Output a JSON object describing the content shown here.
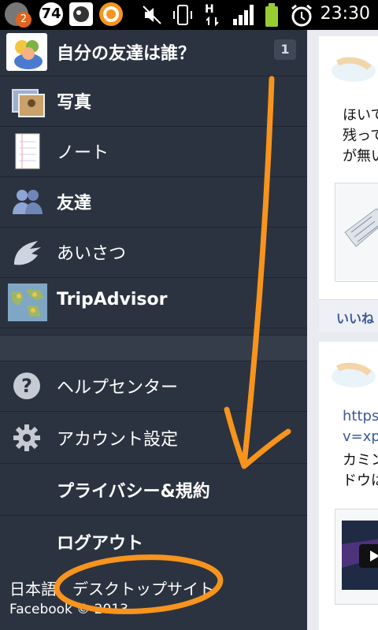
{
  "status_bar": {
    "notif_count": "2",
    "battery_badge": "74",
    "network": "H",
    "time": "23:30"
  },
  "menu": {
    "profile_question": "自分の友達は誰？",
    "profile_badge": "1",
    "items": [
      {
        "label": "写真",
        "icon": "photos-icon"
      },
      {
        "label": "ノート",
        "icon": "notes-icon"
      },
      {
        "label": "友達",
        "icon": "friends-icon"
      },
      {
        "label": "あいさつ",
        "icon": "poke-icon"
      },
      {
        "label": "TripAdvisor",
        "icon": "tripadvisor-map-icon"
      }
    ],
    "help": "ヘルプセンター",
    "account": "アカウント設定",
    "privacy": "プライバシー&規約",
    "logout": "ログアウト"
  },
  "footer": {
    "language": "日本語",
    "desktop_site": "デスクトップサイト",
    "copyright": "Facebook © 2013"
  },
  "feed": {
    "post1_lines": [
      "ほいで",
      "残って",
      "が無い"
    ],
    "like": "いいね",
    "post2_lines": [
      "https:",
      "v=xpH",
      "カミン",
      "ドウは"
    ]
  },
  "colors": {
    "menu_bg": "#2c3340",
    "annotation": "#f7941d",
    "link": "#3b5998"
  }
}
